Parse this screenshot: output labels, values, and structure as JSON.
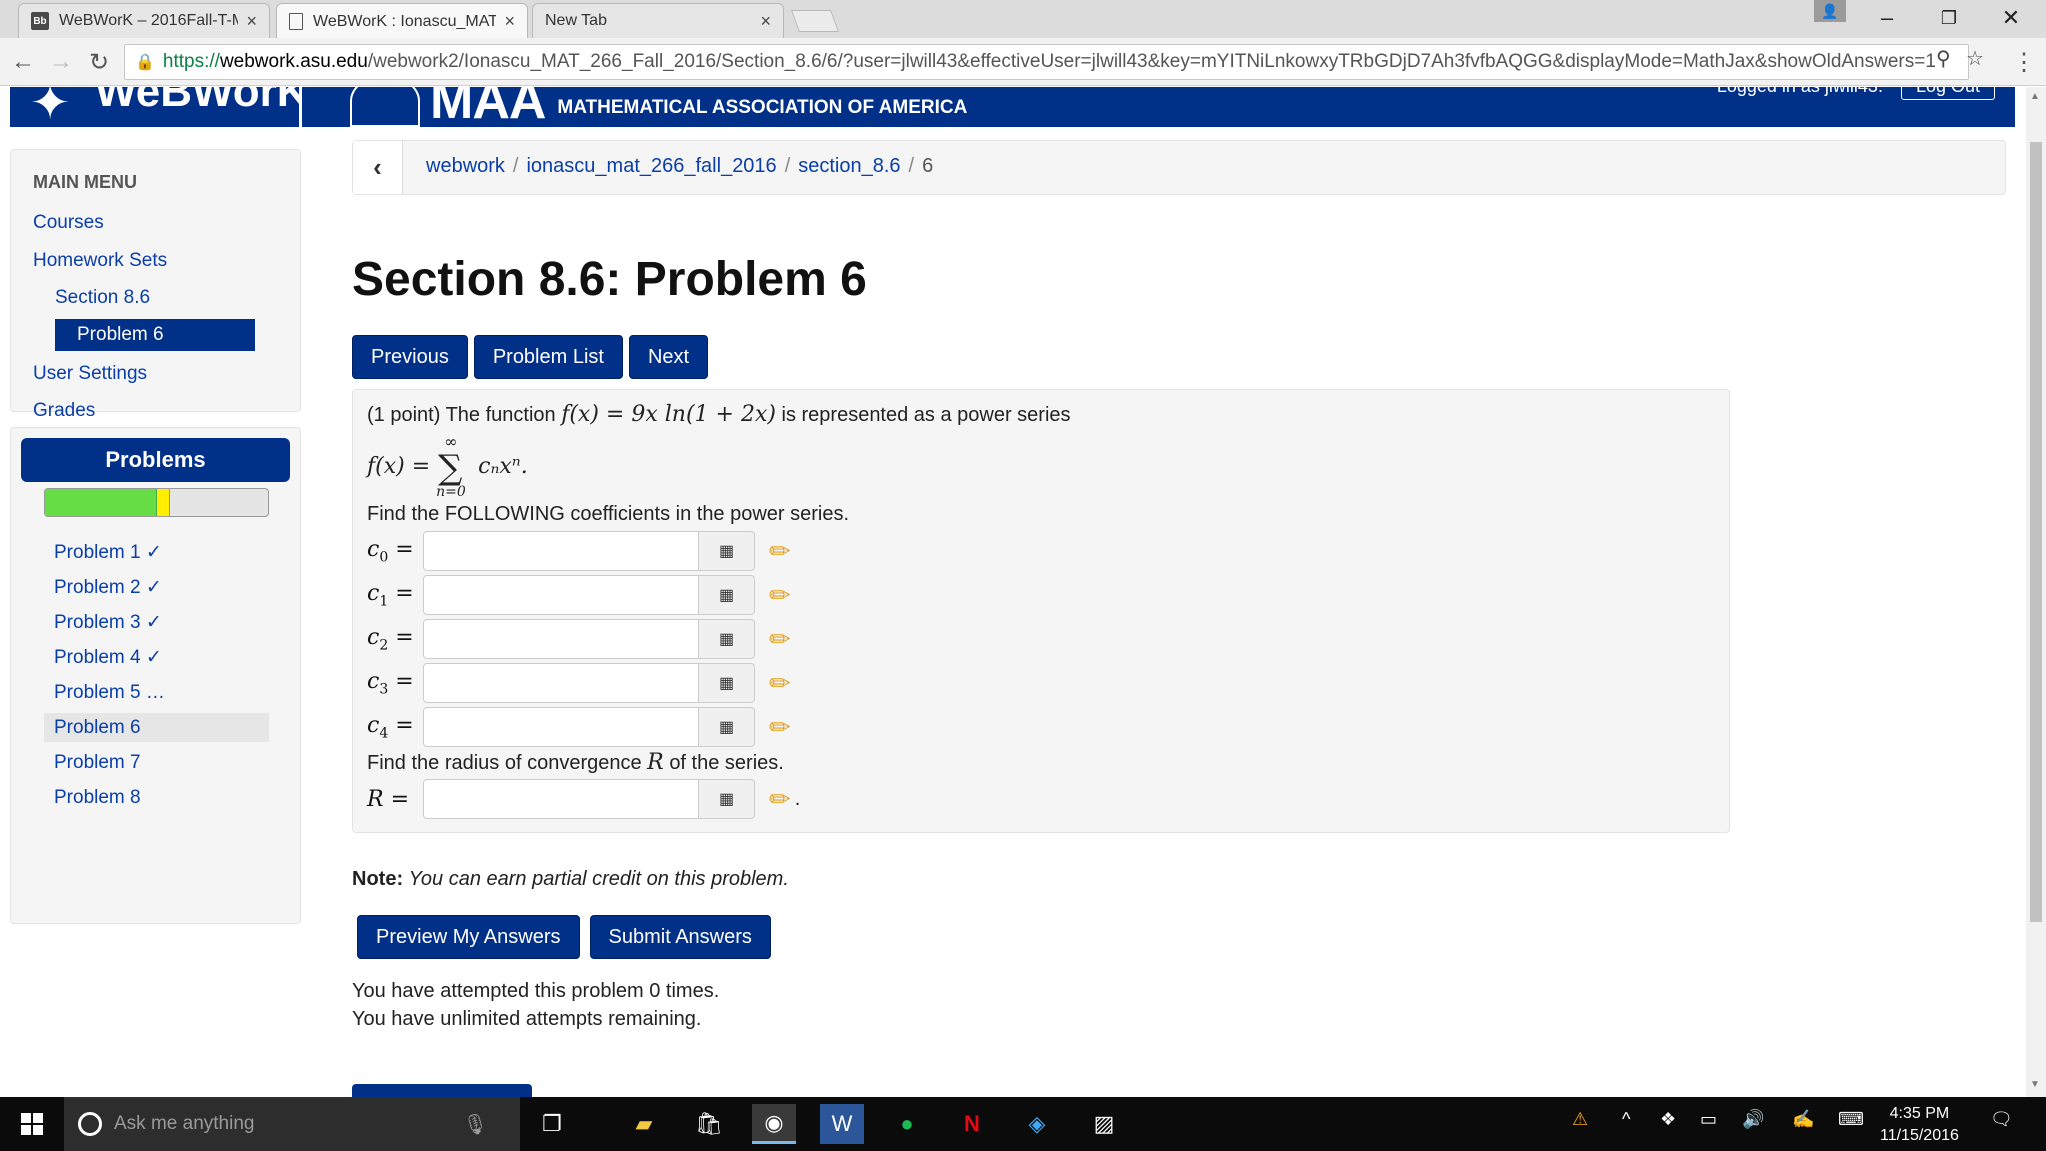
{
  "browser": {
    "tabs": [
      {
        "favicon": "Bb",
        "title": "WeBWorK – 2016Fall-T-M",
        "active": false
      },
      {
        "favicon": "doc",
        "title": "WeBWorK : Ionascu_MAT",
        "active": true
      },
      {
        "favicon": "",
        "title": "New Tab",
        "active": false
      }
    ],
    "url": {
      "scheme": "https://",
      "host": "webwork.asu.edu",
      "path": "/webwork2/Ionascu_MAT_266_Fall_2016/Section_8.6/6/?user=jlwill43&effectiveUser=jlwill43&key=mYITNiLnkowxyTRbGDjD7Ah3fvfbAQGG&displayMode=MathJax&showOldAnswers=1"
    }
  },
  "header": {
    "logo": "WeBWorK",
    "maa": "MAA",
    "maa_sub": "MATHEMATICAL ASSOCIATION OF AMERICA",
    "logged_in": "Logged in as jlwill43.",
    "logout": "Log Out"
  },
  "sidebar": {
    "heading": "MAIN MENU",
    "items": [
      "Courses",
      "Homework Sets",
      "Section 8.6",
      "Problem 6",
      "User Settings",
      "Grades"
    ],
    "problems_title": "Problems",
    "progress": {
      "correct_fraction": 0.5,
      "partial_fraction": 0.0625
    },
    "problem_links": [
      "Problem 1 ✓",
      "Problem 2 ✓",
      "Problem 3 ✓",
      "Problem 4 ✓",
      "Problem 5 …",
      "Problem 6",
      "Problem 7",
      "Problem 8"
    ]
  },
  "breadcrumb": {
    "items": [
      "webwork",
      "ionascu_mat_266_fall_2016",
      "section_8.6"
    ],
    "current": "6",
    "sep": "/"
  },
  "main": {
    "title": "Section 8.6: Problem 6",
    "nav": {
      "previous": "Previous",
      "problem_list": "Problem List",
      "next": "Next"
    },
    "problem": {
      "intro_prefix": "(1 point) The function",
      "function": "f(x) = 9x ln(1 + 2x)",
      "intro_suffix": "is represented as a power series",
      "series_lhs": "f(x) =",
      "sigma_top": "∞",
      "sigma_bottom": "n=0",
      "series_term": "cₙxⁿ.",
      "find_coeff": "Find the FOLLOWING coefficients in the power series.",
      "answers": [
        {
          "label": "c",
          "sub": "0",
          "value": ""
        },
        {
          "label": "c",
          "sub": "1",
          "value": ""
        },
        {
          "label": "c",
          "sub": "2",
          "value": ""
        },
        {
          "label": "c",
          "sub": "3",
          "value": ""
        },
        {
          "label": "c",
          "sub": "4",
          "value": ""
        }
      ],
      "find_radius_prefix": "Find the radius of convergence",
      "radius_symbol": "R",
      "find_radius_suffix": "of the series.",
      "radius_label": "R",
      "radius_value": ""
    },
    "note_label": "Note:",
    "note_text": "You can earn partial credit on this problem.",
    "preview_button": "Preview My Answers",
    "submit_button": "Submit Answers",
    "attempts_line": "You have attempted this problem 0 times.",
    "remaining_line": "You have unlimited attempts remaining."
  },
  "taskbar": {
    "search_placeholder": "Ask me anything",
    "time": "4:35 PM",
    "date": "11/15/2016"
  }
}
